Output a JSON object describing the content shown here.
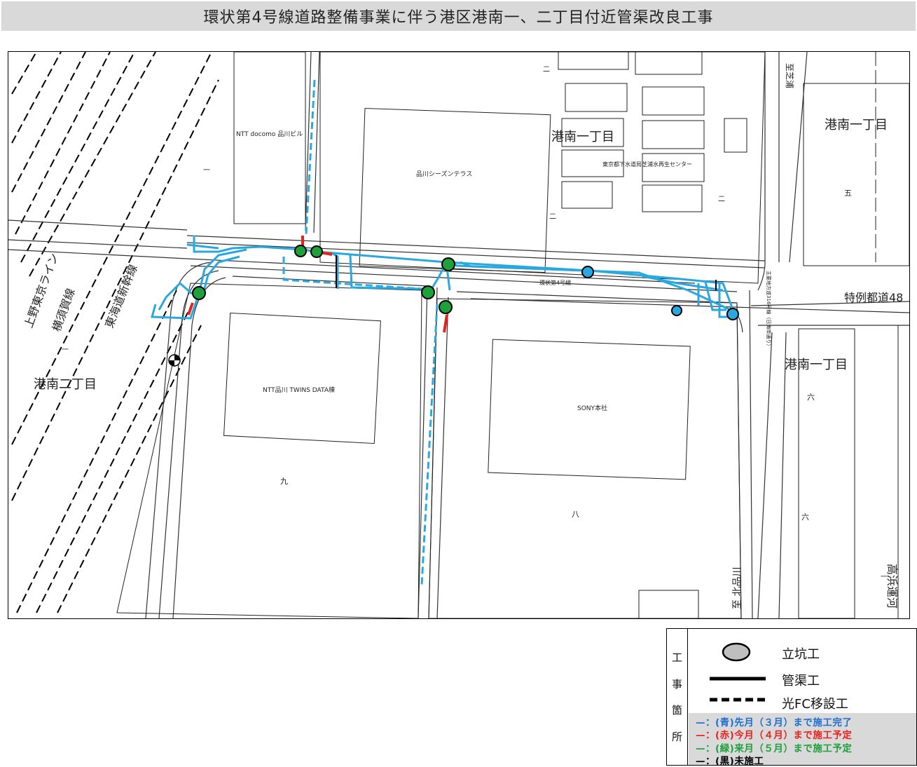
{
  "header": {
    "title": "環状第4号線道路整備事業に伴う港区港南一、二丁目付近管渠改良工事"
  },
  "map": {
    "labels": {
      "docomo": "NTT docomo 品川ビル",
      "seasons": "品川シーズンテラス",
      "konan1_top": "港南一丁目",
      "sewer": "東京都下水道局芝浦水再生センター",
      "konan1_right": "港南一丁目",
      "go": "五",
      "konan2": "港南二丁目",
      "twins": "NTT品川 TWINS DATA棟",
      "sony": "SONY本社",
      "kyu": "九",
      "hachi": "八",
      "konan1_mid": "港南一丁目",
      "roku1": "六",
      "roku2": "六",
      "kanjo4": "環状第4号線",
      "tokurei": "特例都道48",
      "shuyo": "主要地方道316号線（日海岸通り）",
      "shibaura": "至芝浦",
      "kitashinagawa": "至 北品川",
      "takahama": "高浜運河",
      "ueno": "上野東京ライン",
      "yokosuka": "横須賀線",
      "tokaido": "東海道新幹線",
      "ni1": "二",
      "ni2": "二",
      "ni3": "二",
      "ichi1": "一",
      "ichi2": "一",
      "ichi3": "一"
    },
    "colors": {
      "done_blue": "#29a8e0",
      "this_month_red": "#e8211f",
      "next_month_green": "#1ea03a",
      "not_started_black": "#000000"
    }
  },
  "legend": {
    "side_chars": [
      "工",
      "事",
      "箇",
      "所"
    ],
    "shaft_label": "立坑工",
    "pipe_label": "管渠工",
    "fc_label": "光FC移設工",
    "status": [
      {
        "text": "—：(青)先月（３月）まで施工完了",
        "color": "#1e6fd0"
      },
      {
        "text": "—：(赤)今月（４月）まで施工予定",
        "color": "#e8211f"
      },
      {
        "text": "—：(緑)来月（５月）まで施工予定",
        "color": "#1ea03a"
      },
      {
        "text": "—：(黒)未施工",
        "color": "#000000"
      }
    ]
  }
}
